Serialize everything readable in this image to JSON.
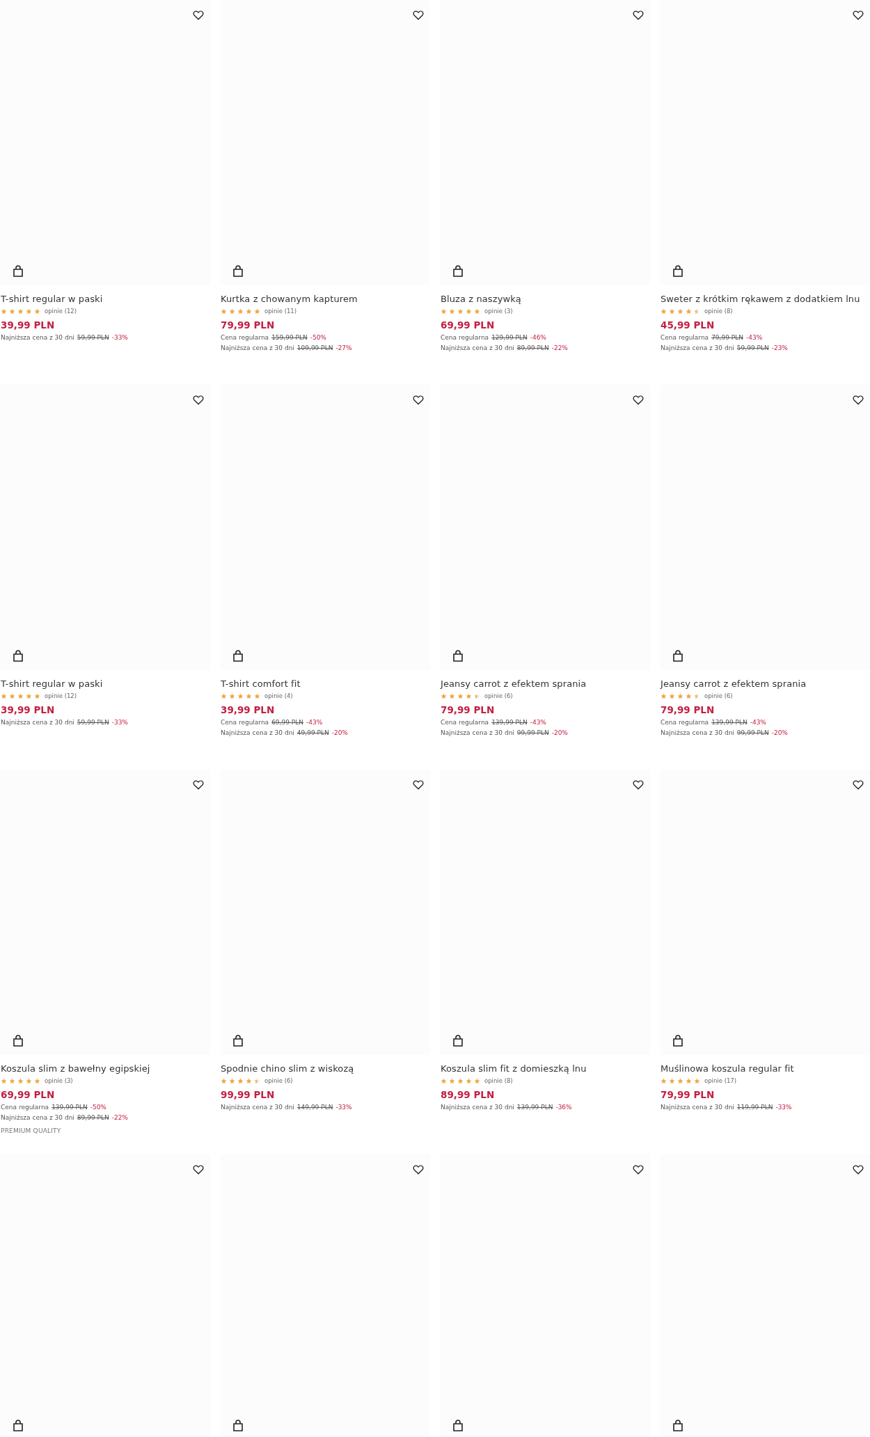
{
  "products": [
    {
      "kind": "full",
      "title": "T-shirt regular w paski",
      "stars": 5,
      "reviews": "opinie (12)",
      "price": "39,99 PLN",
      "lowest": {
        "label": "Najniższa cena z 30 dni",
        "old": "59,99 PLN",
        "discount": "-33%"
      }
    },
    {
      "kind": "full",
      "title": "Kurtka z chowanym kapturem",
      "stars": 5,
      "reviews": "opinie (11)",
      "price": "79,99 PLN",
      "regular": {
        "label": "Cena regularna",
        "old": "159,99 PLN",
        "discount": "-50%"
      },
      "lowest": {
        "label": "Najniższa cena z 30 dni",
        "old": "109,99 PLN",
        "discount": "-27%"
      }
    },
    {
      "kind": "full",
      "title": "Bluza z naszywką",
      "stars": 5,
      "reviews": "opinie (3)",
      "price": "69,99 PLN",
      "regular": {
        "label": "Cena regularna",
        "old": "129,99 PLN",
        "discount": "-46%"
      },
      "lowest": {
        "label": "Najniższa cena z 30 dni",
        "old": "89,99 PLN",
        "discount": "-22%"
      }
    },
    {
      "kind": "full",
      "title": "Sweter z krótkim rękawem z dodatkiem lnu",
      "stars": 4.5,
      "reviews": "opinie (8)",
      "price": "45,99 PLN",
      "regular": {
        "label": "Cena regularna",
        "old": "79,99 PLN",
        "discount": "-43%"
      },
      "lowest": {
        "label": "Najniższa cena z 30 dni",
        "old": "59,99 PLN",
        "discount": "-23%"
      }
    },
    {
      "kind": "full",
      "title": "T-shirt regular w paski",
      "stars": 5,
      "reviews": "opinie (12)",
      "price": "39,99 PLN",
      "lowest": {
        "label": "Najniższa cena z 30 dni",
        "old": "59,99 PLN",
        "discount": "-33%"
      }
    },
    {
      "kind": "full",
      "title": "T-shirt comfort fit",
      "stars": 5,
      "reviews": "opinie (4)",
      "price": "39,99 PLN",
      "regular": {
        "label": "Cena regularna",
        "old": "69,99 PLN",
        "discount": "-43%"
      },
      "lowest": {
        "label": "Najniższa cena z 30 dni",
        "old": "49,99 PLN",
        "discount": "-20%"
      }
    },
    {
      "kind": "full",
      "title": "Jeansy carrot z efektem sprania",
      "stars": 4.5,
      "reviews": "opinie (6)",
      "price": "79,99 PLN",
      "regular": {
        "label": "Cena regularna",
        "old": "139,99 PLN",
        "discount": "-43%"
      },
      "lowest": {
        "label": "Najniższa cena z 30 dni",
        "old": "99,99 PLN",
        "discount": "-20%"
      }
    },
    {
      "kind": "full",
      "title": "Jeansy carrot z efektem sprania",
      "stars": 4.5,
      "reviews": "opinie (6)",
      "price": "79,99 PLN",
      "regular": {
        "label": "Cena regularna",
        "old": "139,99 PLN",
        "discount": "-43%"
      },
      "lowest": {
        "label": "Najniższa cena z 30 dni",
        "old": "99,99 PLN",
        "discount": "-20%"
      }
    },
    {
      "kind": "full",
      "title": "Koszula slim z bawełny egipskiej",
      "stars": 5,
      "reviews": "opinie (3)",
      "price": "69,99 PLN",
      "regular": {
        "label": "Cena regularna",
        "old": "139,99 PLN",
        "discount": "-50%"
      },
      "lowest": {
        "label": "Najniższa cena z 30 dni",
        "old": "89,99 PLN",
        "discount": "-22%"
      },
      "badge": "PREMIUM QUALITY"
    },
    {
      "kind": "full",
      "title": "Spodnie chino slim z wiskozą",
      "stars": 4.5,
      "reviews": "opinie (6)",
      "price": "99,99 PLN",
      "lowest": {
        "label": "Najniższa cena z 30 dni",
        "old": "149,99 PLN",
        "discount": "-33%"
      }
    },
    {
      "kind": "full",
      "title": "Koszula slim fit z domieszką lnu",
      "stars": 5,
      "reviews": "opinie (8)",
      "price": "89,99 PLN",
      "lowest": {
        "label": "Najniższa cena z 30 dni",
        "old": "139,99 PLN",
        "discount": "-36%"
      }
    },
    {
      "kind": "full",
      "title": "Muślinowa koszula regular fit",
      "stars": 5,
      "reviews": "opinie (17)",
      "price": "79,99 PLN",
      "lowest": {
        "label": "Najniższa cena z 30 dni",
        "old": "119,99 PLN",
        "discount": "-33%"
      }
    },
    {
      "kind": "cut-off"
    },
    {
      "kind": "cut-off"
    },
    {
      "kind": "cut-off"
    },
    {
      "kind": "cut-off"
    }
  ]
}
